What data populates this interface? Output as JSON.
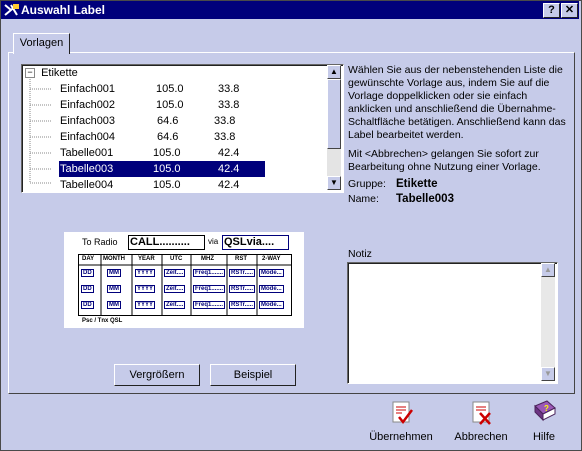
{
  "window": {
    "title": "Auswahl Label",
    "help_btn": "?",
    "close_btn": "✕"
  },
  "tabs": [
    {
      "label": "Vorlagen"
    }
  ],
  "tree": {
    "root": "Etikette",
    "items": [
      {
        "name": "Einfach001",
        "w": "105.0",
        "h": "33.8",
        "selected": false
      },
      {
        "name": "Einfach002",
        "w": "105.0",
        "h": "33.8",
        "selected": false
      },
      {
        "name": "Einfach003",
        "w": "64.6",
        "h": "33.8",
        "selected": false
      },
      {
        "name": "Einfach004",
        "w": "64.6",
        "h": "33.8",
        "selected": false
      },
      {
        "name": "Tabelle001",
        "w": "105.0",
        "h": "42.4",
        "selected": false
      },
      {
        "name": "Tabelle003",
        "w": "105.0",
        "h": "42.4",
        "selected": true
      },
      {
        "name": "Tabelle004",
        "w": "105.0",
        "h": "42.4",
        "selected": false
      }
    ]
  },
  "description": {
    "p1": "Wählen Sie aus der nebenstehenden Liste die gewünschte Vorlage aus, indem Sie auf die Vorlage doppelklicken oder sie einfach anklicken und anschließend die Übernahme-Schaltfläche betätigen.        Anschließend kann das Label bearbeitet werden.",
    "p2": "Mit <Abbrechen> gelangen Sie sofort zur Bearbeitung ohne Nutzung einer Vorlage.",
    "group_label": "Gruppe:",
    "group_value": "Etikette",
    "name_label": "Name:",
    "name_value": "Tabelle003"
  },
  "preview": {
    "to_radio": "To Radio",
    "call": "CALL..........",
    "via": "via",
    "qsl_via": "QSLvia....",
    "headers": [
      "DAY",
      "MONTH",
      "YEAR",
      "UTC",
      "MHZ",
      "RST",
      "2-WAY"
    ],
    "cells": [
      "DD",
      "MM",
      "YYYY",
      "Zeit....",
      "Freq1.......",
      "RSTr.....",
      "Mode..."
    ],
    "footer": "Psc / Tnx   QSL"
  },
  "notiz": {
    "label": "Notiz",
    "value": ""
  },
  "buttons": {
    "enlarge": "Vergrößern",
    "example": "Beispiel"
  },
  "actions": {
    "accept": "Übernehmen",
    "cancel": "Abbrechen",
    "help": "Hilfe"
  }
}
